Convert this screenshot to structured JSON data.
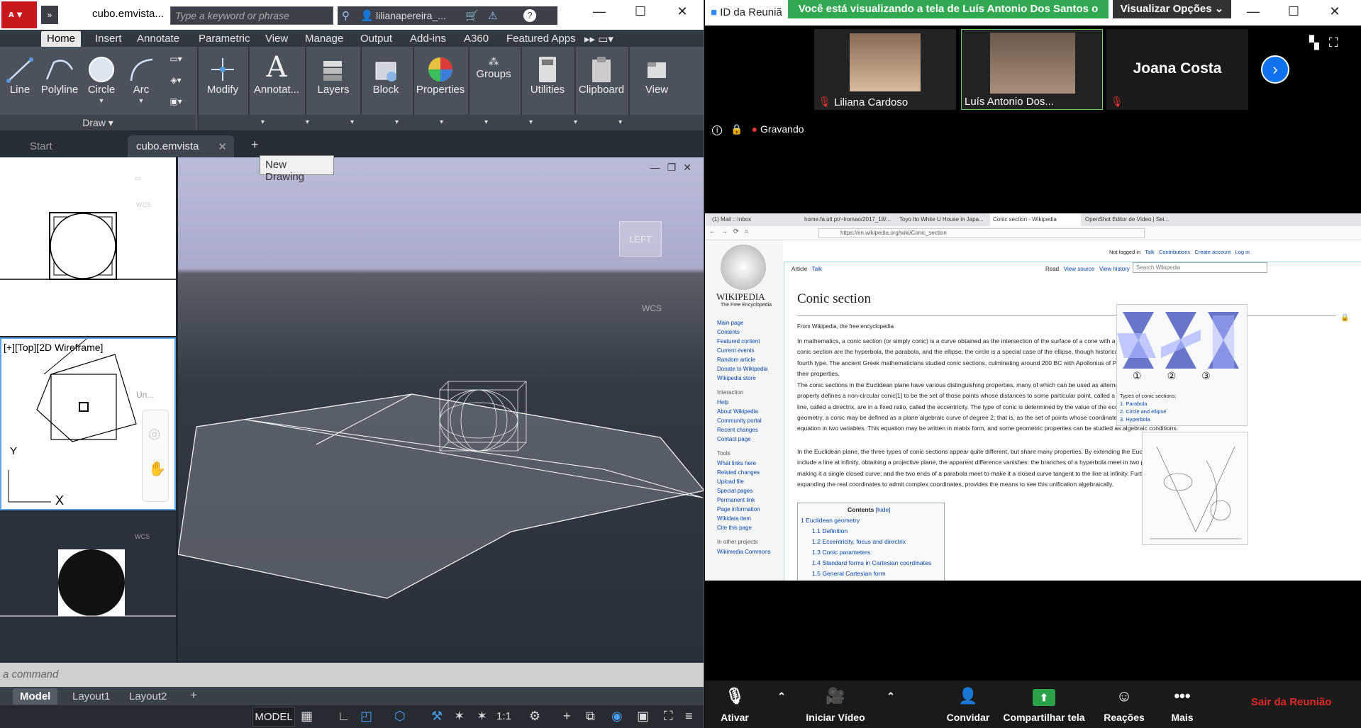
{
  "cad": {
    "app_logo": "A",
    "filename": "cubo.emvista...",
    "search_placeholder": "Type a keyword or phrase",
    "user": "lilianapereira_...",
    "ribbon_tabs": [
      "Home",
      "Insert",
      "Annotate",
      "Parametric",
      "View",
      "Manage",
      "Output",
      "Add-ins",
      "A360",
      "Featured Apps"
    ],
    "draw_tools": [
      "Line",
      "Polyline",
      "Circle",
      "Arc"
    ],
    "panels": [
      "Modify",
      "Annotat...",
      "Layers",
      "Block",
      "Properties",
      "Groups",
      "Utilities",
      "Clipboard",
      "View"
    ],
    "draw_panel_label": "Draw",
    "doc_tabs": [
      "Start",
      "cubo.emvista"
    ],
    "tooltip": "New Drawing",
    "vp2_label": "[+][Top][2D Wireframe]",
    "vp2_unnamed": "Un...",
    "wcs": "WCS",
    "viewcube_face": "LEFT",
    "command_placeholder": "a command",
    "layout_tabs": [
      "Model",
      "Layout1",
      "Layout2"
    ],
    "status_model": "MODEL",
    "status_scale": "1:1",
    "axis_y": "Y",
    "axis_x": "X"
  },
  "zoom": {
    "meeting_id": "ID da Reuniã",
    "banner": "Você está visualizando a tela de Luís Antonio Dos Santos o",
    "view_options": "Visualizar Opções",
    "participants": [
      "Liliana Cardoso",
      "Luís Antonio Dos...",
      "Joana Costa"
    ],
    "recording": "Gravando",
    "bottom": {
      "mute": "Ativar",
      "video": "Iniciar Vídeo",
      "invite": "Convidar",
      "share": "Compartilhar tela",
      "reactions": "Reações",
      "more": "Mais",
      "leave": "Sair da Reunião"
    }
  },
  "browser": {
    "tabs": [
      "(1) Mail :: Inbox",
      "home.fa.utl.pt/~lromao/2017_18/...",
      "Toyo Ito White U House in Japa...",
      "Conic section - Wikipedia",
      "OpenShot Editor de Vídeo | Sei..."
    ],
    "url": "https://en.wikipedia.org/wiki/Conic_section",
    "wiki": {
      "user_links": [
        "Not logged in",
        "Talk",
        "Contributions",
        "Create account",
        "Log in"
      ],
      "page_tabs": [
        "Article",
        "Talk"
      ],
      "action_tabs": [
        "Read",
        "View source",
        "View history"
      ],
      "search_placeholder": "Search Wikipedia",
      "logo_text": "WIKIPEDIA",
      "logo_sub": "The Free Encyclopedia",
      "title": "Conic section",
      "subtitle": "From Wikipedia, the free encyclopedia",
      "nav": [
        "Main page",
        "Contents",
        "Featured content",
        "Current events",
        "Random article",
        "Donate to Wikipedia",
        "Wikipedia store"
      ],
      "interaction_heading": "Interaction",
      "interaction": [
        "Help",
        "About Wikipedia",
        "Community portal",
        "Recent changes",
        "Contact page"
      ],
      "tools_heading": "Tools",
      "tools": [
        "What links here",
        "Related changes",
        "Upload file",
        "Special pages",
        "Permanent link",
        "Page information",
        "Wikidata item",
        "Cite this page"
      ],
      "projects_heading": "In other projects",
      "projects": [
        "Wikimedia Commons"
      ],
      "para1": "In mathematics, a conic section (or simply conic) is a curve obtained as the intersection of the surface of a cone with a plane. The three types of conic section are the hyperbola, the parabola, and the ellipse; the circle is a special case of the ellipse, though historically it was sometimes called a fourth type. The ancient Greek mathematicians studied conic sections, culminating around 200 BC with Apollonius of Perga's systematic work on their properties.",
      "para2": "The conic sections in the Euclidean plane have various distinguishing properties, many of which can be used as alternative definitions. One such property defines a non-circular conic[1] to be the set of those points whose distances to some particular point, called a focus, and some particular line, called a directrix, are in a fixed ratio, called the eccentricity. The type of conic is determined by the value of the eccentricity. In analytic geometry, a conic may be defined as a plane algebraic curve of degree 2; that is, as the set of points whose coordinates satisfy a quadratic equation in two variables. This equation may be written in matrix form, and some geometric properties can be studied as algebraic conditions.",
      "para3": "In the Euclidean plane, the three types of conic sections appear quite different, but share many properties. By extending the Euclidean plane to include a line at infinity, obtaining a projective plane, the apparent difference vanishes: the branches of a hyperbola meet in two points at infinity, making it a single closed curve; and the two ends of a parabola meet to make it a closed curve tangent to the line at infinity. Further extension, by expanding the real coordinates to admit complex coordinates, provides the means to see this unification algebraically.",
      "toc_title": "Contents",
      "toc_hide": "[hide]",
      "toc": [
        "1 Euclidean geometry",
        "1.1 Definition",
        "1.2 Eccentricity, focus and directrix",
        "1.3 Conic parameters",
        "1.4 Standard forms in Cartesian coordinates",
        "1.5 General Cartesian form"
      ],
      "infobox_caption": "Types of conic sections:",
      "infobox_items": [
        "1. Parabola",
        "2. Circle and ellipse",
        "3. Hyperbola"
      ],
      "infobox_nums": [
        "①",
        "②",
        "③"
      ]
    }
  }
}
